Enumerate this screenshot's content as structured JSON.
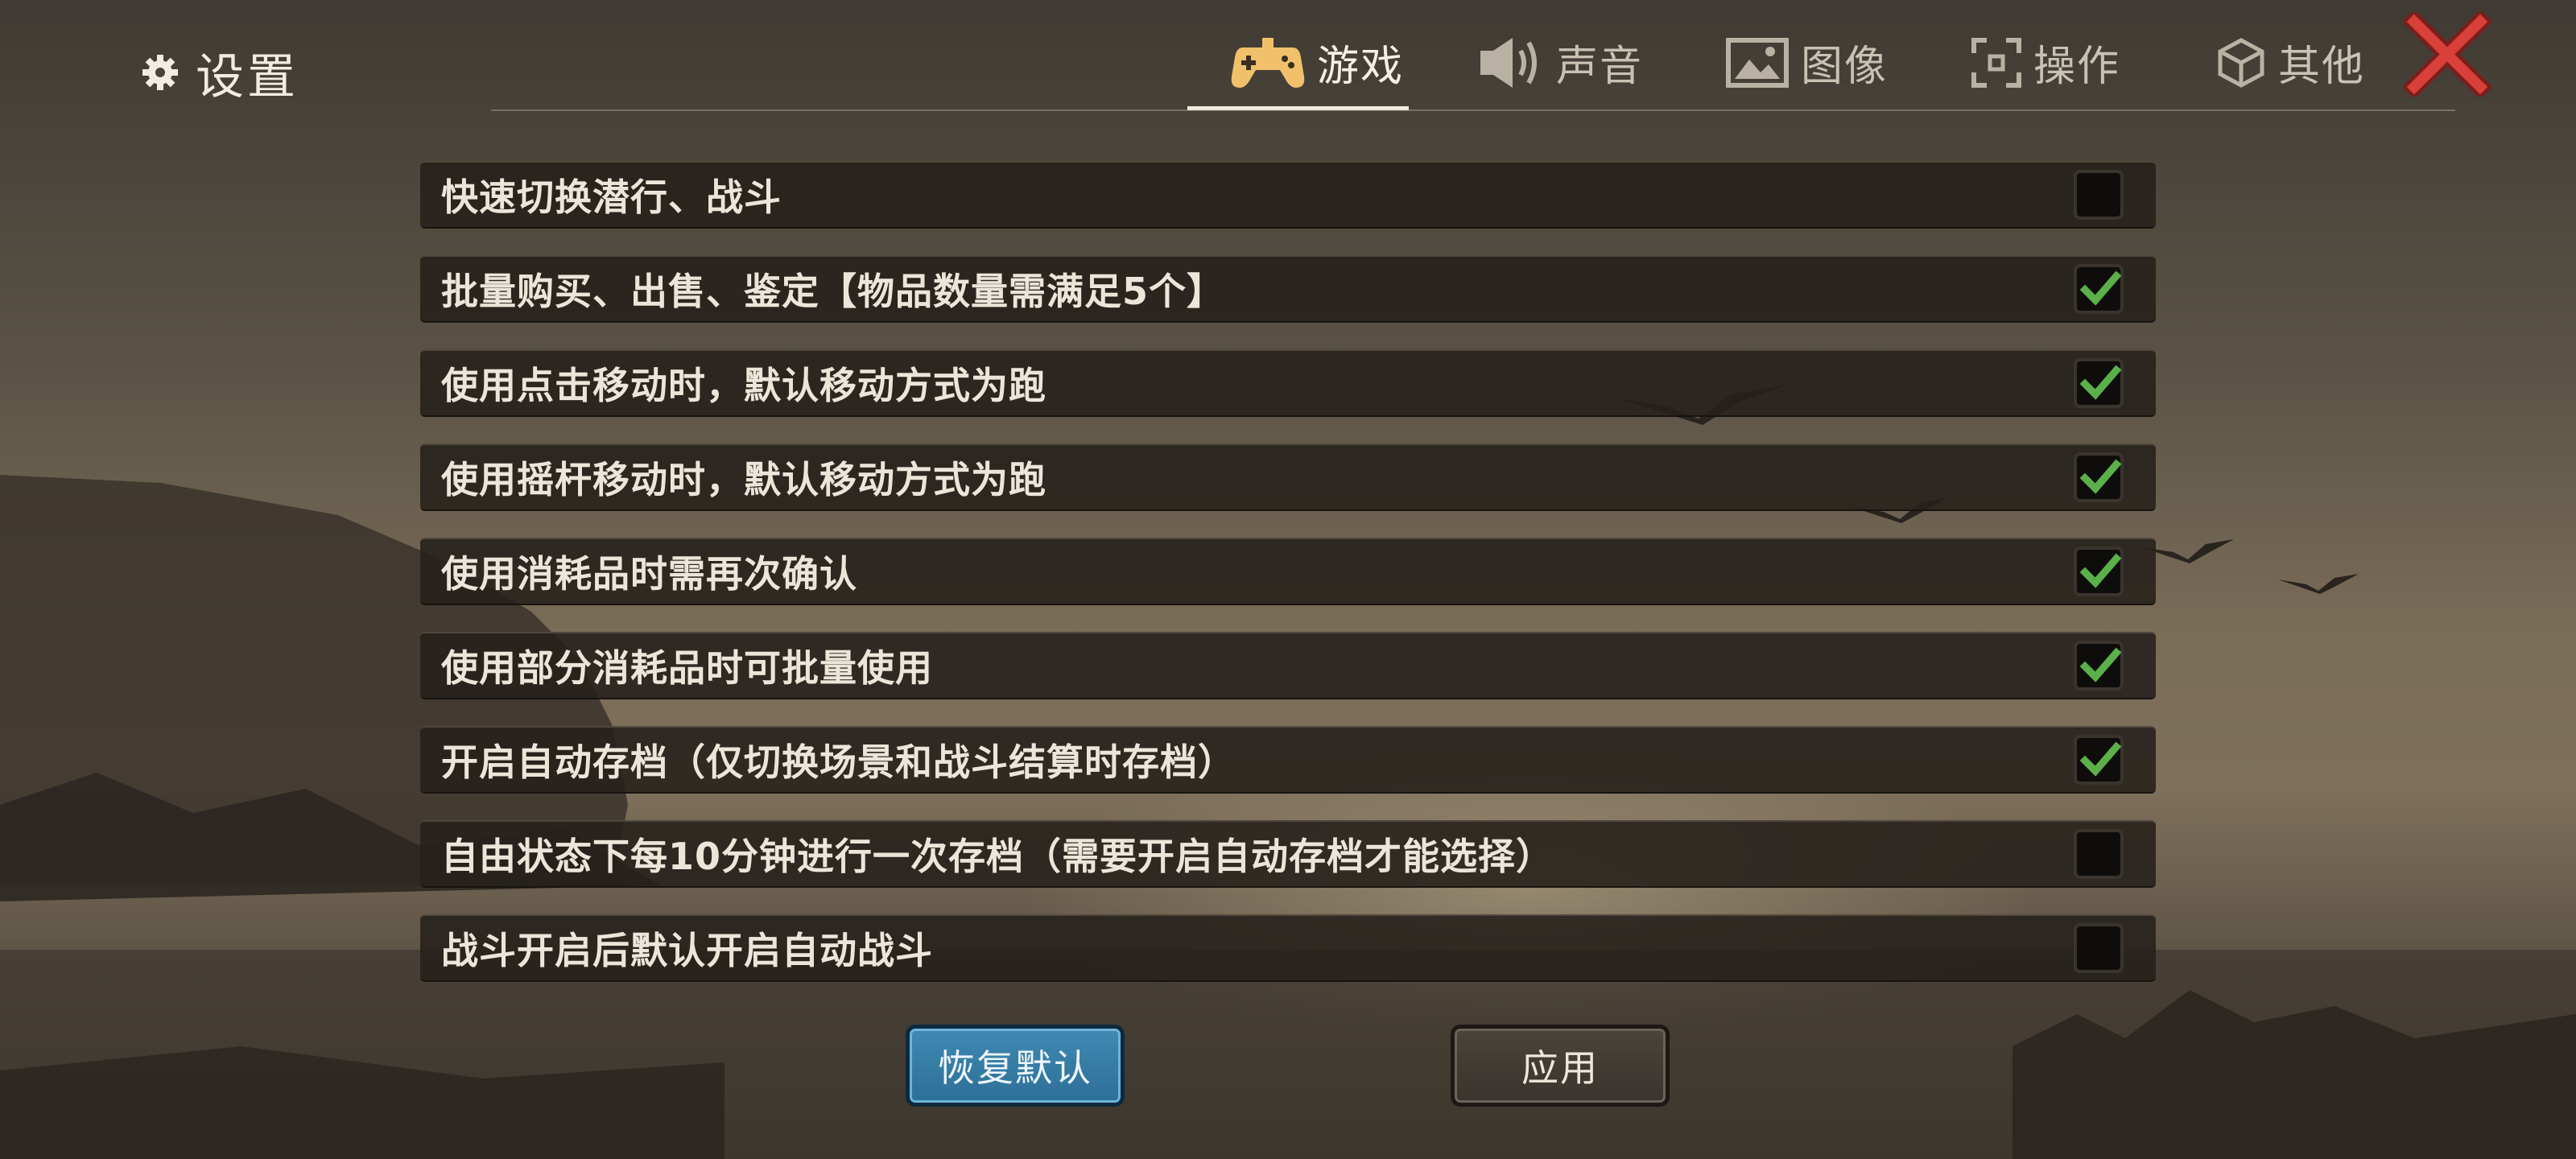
{
  "title": "设置",
  "tabs": [
    {
      "label": "游戏",
      "icon": "gamepad-icon",
      "active": true
    },
    {
      "label": "声音",
      "icon": "speaker-icon",
      "active": false
    },
    {
      "label": "图像",
      "icon": "image-icon",
      "active": false
    },
    {
      "label": "操作",
      "icon": "crosshair-icon",
      "active": false
    },
    {
      "label": "其他",
      "icon": "cube-icon",
      "active": false
    }
  ],
  "options": [
    {
      "label": "快速切换潜行、战斗",
      "checked": false
    },
    {
      "label": "批量购买、出售、鉴定【物品数量需满足5个】",
      "checked": true
    },
    {
      "label": "使用点击移动时，默认移动方式为跑",
      "checked": true
    },
    {
      "label": "使用摇杆移动时，默认移动方式为跑",
      "checked": true
    },
    {
      "label": "使用消耗品时需再次确认",
      "checked": true
    },
    {
      "label": "使用部分消耗品时可批量使用",
      "checked": true
    },
    {
      "label": "开启自动存档（仅切换场景和战斗结算时存档）",
      "checked": true
    },
    {
      "label": "自由状态下每10分钟进行一次存档（需要开启自动存档才能选择）",
      "checked": false
    },
    {
      "label": "战斗开启后默认开启自动战斗",
      "checked": false
    }
  ],
  "buttons": {
    "restore_label": "恢复默认",
    "apply_label": "应用"
  },
  "colors": {
    "accent_blue": "#2d6f97",
    "check_green": "#5bb04a",
    "close_red": "#d9403a"
  }
}
